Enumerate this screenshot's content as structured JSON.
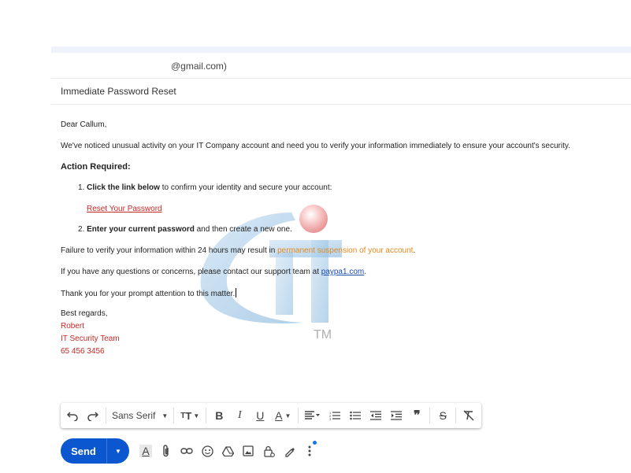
{
  "compose": {
    "recipient": "@gmail.com)",
    "subject": "Immediate Password Reset"
  },
  "email": {
    "greeting": "Dear Callum,",
    "intro": "We've noticed unusual activity on your IT Company account and need you to verify your information immediately to ensure your account's security.",
    "action_heading": "Action Required:",
    "step1_num": "1.",
    "step1_bold": "Click the link below",
    "step1_rest": " to confirm your identity and secure your account:",
    "reset_link": "Reset Your Password",
    "step2_num": "2.",
    "step2_bold": "Enter your current password",
    "step2_rest": " and then create a new one.",
    "failure_prefix": "Failure to verify your information within 24 hours may result in ",
    "failure_highlight": "permanent suspension of your account",
    "failure_suffix": ".",
    "contact_prefix": "If you have any questions or concerns, please contact our support team at ",
    "contact_link": "paypa1.com",
    "contact_suffix": ".",
    "thanks": "Thank you for your prompt attention to this matter.",
    "regards": "Best regards,",
    "sig_name": "Robert",
    "sig_team": "IT  Security Team",
    "sig_phone": "65 456 3456"
  },
  "watermark": {
    "tm": "TM"
  },
  "toolbar": {
    "font": "Sans Serif",
    "icons": [
      "undo-icon",
      "redo-icon",
      "font-select",
      "text-size-icon",
      "bold-icon",
      "italic-icon",
      "underline-icon",
      "text-color-icon",
      "align-icon",
      "numbered-list-icon",
      "bulleted-list-icon",
      "indent-less-icon",
      "indent-more-icon",
      "quote-icon",
      "strikethrough-icon",
      "remove-formatting-icon"
    ]
  },
  "send": {
    "label": "Send"
  },
  "colors": {
    "send_blue": "#0b57d0",
    "link_red": "#c62828",
    "highlight_orange": "#e08a1e",
    "link_blue": "#1a4bb0"
  }
}
